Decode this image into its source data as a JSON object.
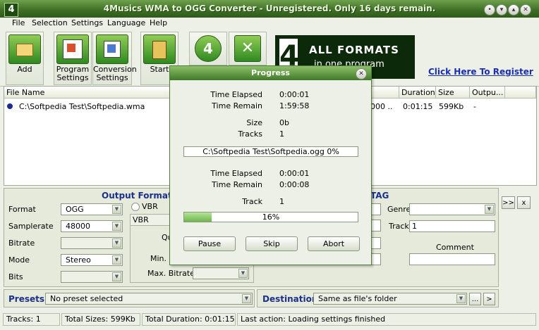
{
  "window": {
    "title": "4Musics WMA to OGG Converter - Unregistered. Only 16 days remain.",
    "logo": "4"
  },
  "menu": [
    "File",
    "Selection",
    "Settings",
    "Language",
    "Help"
  ],
  "toolbar": {
    "add": "Add",
    "program_settings": [
      "Program",
      "Settings"
    ],
    "conversion_settings": [
      "Conversion",
      "Settings"
    ],
    "start": "Start"
  },
  "banner": {
    "logo": "4",
    "line1": "ALL FORMATS",
    "line2": "in one program"
  },
  "register_link": "Click Here To Register",
  "file_list": {
    "columns": [
      "File Name",
      "Duration",
      "Size",
      "Outpu..."
    ],
    "rows": [
      {
        "name": "C:\\Softpedia Test\\Softpedia.wma",
        "partial": "000 ..",
        "duration": "0:01:15",
        "size": "599Kb",
        "output": "-"
      }
    ]
  },
  "output_format": {
    "heading": "Output Format",
    "format_label": "Format",
    "format_value": "OGG",
    "samplerate_label": "Samplerate",
    "samplerate_value": "48000",
    "bitrate_label": "Bitrate",
    "mode_label": "Mode",
    "mode_value": "Stereo",
    "bits_label": "Bits",
    "vbr_label": "VBR",
    "vbr_group": "VBR",
    "quality_partial": "Qu",
    "min_partial": "Min. B",
    "max_bitrate_label": "Max. Bitrate"
  },
  "tag": {
    "heading": "TAG",
    "genre_label": "Genre",
    "track_label": "Track",
    "track_value": "1",
    "comment_label": "Comment"
  },
  "side_buttons": {
    "forward": ">>",
    "clear": "x"
  },
  "presets": {
    "label": "Presets",
    "value": "No preset selected"
  },
  "destination": {
    "label": "Destination",
    "value": "Same as file's folder",
    "browse": "...",
    "go": ">"
  },
  "status": {
    "tracks": "Tracks: 1",
    "total_sizes": "Total Sizes: 599Kb",
    "total_duration": "Total Duration: 0:01:15",
    "last_action": "Last action: Loading settings finished"
  },
  "progress": {
    "title": "Progress",
    "overall": [
      {
        "label": "Time Elapsed",
        "value": "0:00:01"
      },
      {
        "label": "Time Remain",
        "value": "1:59:58"
      },
      {
        "label": "Size",
        "value": "0b"
      },
      {
        "label": "Tracks",
        "value": "1"
      }
    ],
    "file_box": "C:\\Softpedia Test\\Softpedia.ogg  0%",
    "current": [
      {
        "label": "Time Elapsed",
        "value": "0:00:01"
      },
      {
        "label": "Time Remain",
        "value": "0:00:08"
      },
      {
        "label": "Track",
        "value": "1"
      }
    ],
    "percent_text": "16%",
    "percent": 16,
    "buttons": {
      "pause": "Pause",
      "skip": "Skip",
      "abort": "Abort"
    }
  }
}
